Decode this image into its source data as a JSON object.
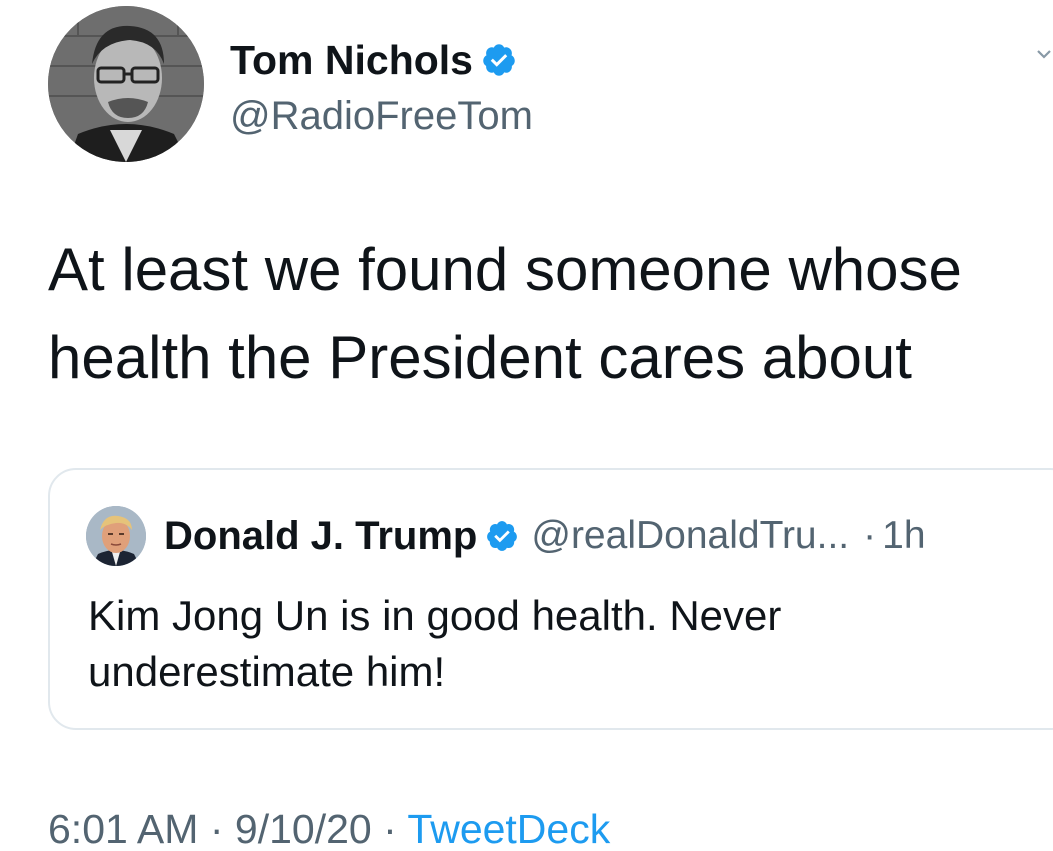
{
  "tweet": {
    "author": {
      "name": "Tom Nichols",
      "handle": "@RadioFreeTom",
      "verified": true
    },
    "text": "At least we found someone whose health the President cares about",
    "quoted": {
      "author": {
        "name": "Donald J. Trump",
        "handle": "@realDonaldTru...",
        "verified": true
      },
      "separator": "·",
      "time": "1h",
      "text": "Kim Jong Un is in good health. Never underestimate him!"
    },
    "footer": {
      "time": "6:01 AM",
      "separator1": "·",
      "date": "9/10/20",
      "separator2": "·",
      "source": "TweetDeck"
    }
  },
  "colors": {
    "verified_blue": "#1d9bf0",
    "secondary_text": "#536471",
    "border": "#e1e8ed"
  },
  "icons": {
    "verified": "verified-badge-icon",
    "menu": "chevron-down-icon"
  }
}
